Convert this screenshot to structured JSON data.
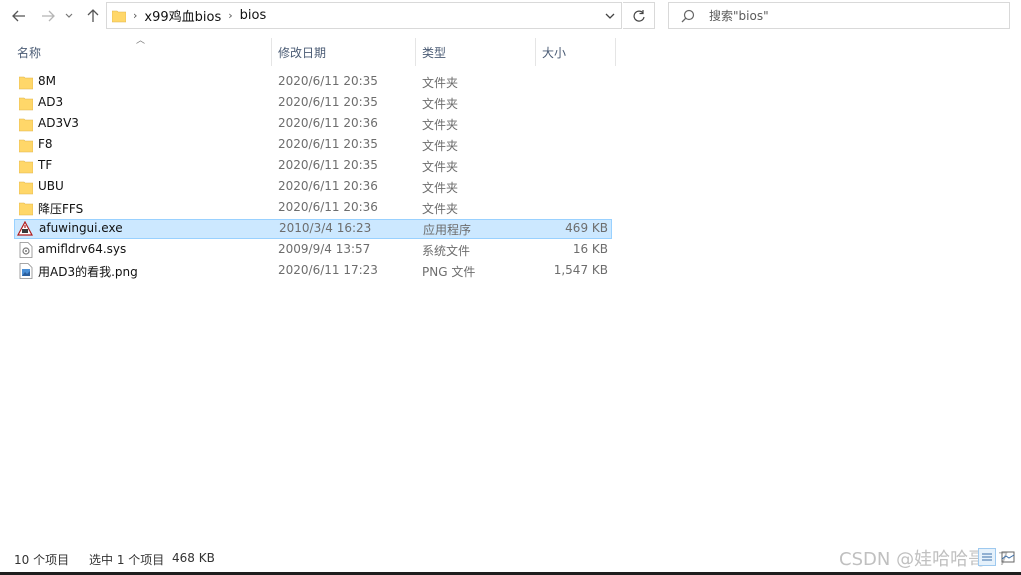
{
  "navigation": {
    "address": [
      "x99鸡血bios",
      "bios"
    ]
  },
  "search": {
    "placeholder": "搜索\"bios\""
  },
  "columns": {
    "name": "名称",
    "date": "修改日期",
    "type": "类型",
    "size": "大小"
  },
  "files": [
    {
      "name": "8M",
      "date": "2020/6/11 20:35",
      "type": "文件夹",
      "size": "",
      "icon": "folder-icon"
    },
    {
      "name": "AD3",
      "date": "2020/6/11 20:35",
      "type": "文件夹",
      "size": "",
      "icon": "folder-icon"
    },
    {
      "name": "AD3V3",
      "date": "2020/6/11 20:36",
      "type": "文件夹",
      "size": "",
      "icon": "folder-icon"
    },
    {
      "name": "F8",
      "date": "2020/6/11 20:35",
      "type": "文件夹",
      "size": "",
      "icon": "folder-icon"
    },
    {
      "name": "TF",
      "date": "2020/6/11 20:35",
      "type": "文件夹",
      "size": "",
      "icon": "folder-icon"
    },
    {
      "name": "UBU",
      "date": "2020/6/11 20:36",
      "type": "文件夹",
      "size": "",
      "icon": "folder-icon"
    },
    {
      "name": "降压FFS",
      "date": "2020/6/11 20:36",
      "type": "文件夹",
      "size": "",
      "icon": "folder-icon"
    },
    {
      "name": "afuwingui.exe",
      "date": "2010/3/4 16:23",
      "type": "应用程序",
      "size": "469 KB",
      "icon": "exe-icon",
      "selected": true
    },
    {
      "name": "amifldrv64.sys",
      "date": "2009/9/4 13:57",
      "type": "系统文件",
      "size": "16 KB",
      "icon": "sys-file-icon"
    },
    {
      "name": "用AD3的看我.png",
      "date": "2020/6/11 17:23",
      "type": "PNG 文件",
      "size": "1,547 KB",
      "icon": "png-file-icon"
    }
  ],
  "status": {
    "count": "10 个项目",
    "selected": "选中 1 个项目",
    "selected_size": "468 KB"
  },
  "watermark": "CSDN @娃哈哈哥57",
  "colors": {
    "selection": "#cce8ff",
    "selection_border": "#99d1ff",
    "folder": "#ffd769"
  }
}
